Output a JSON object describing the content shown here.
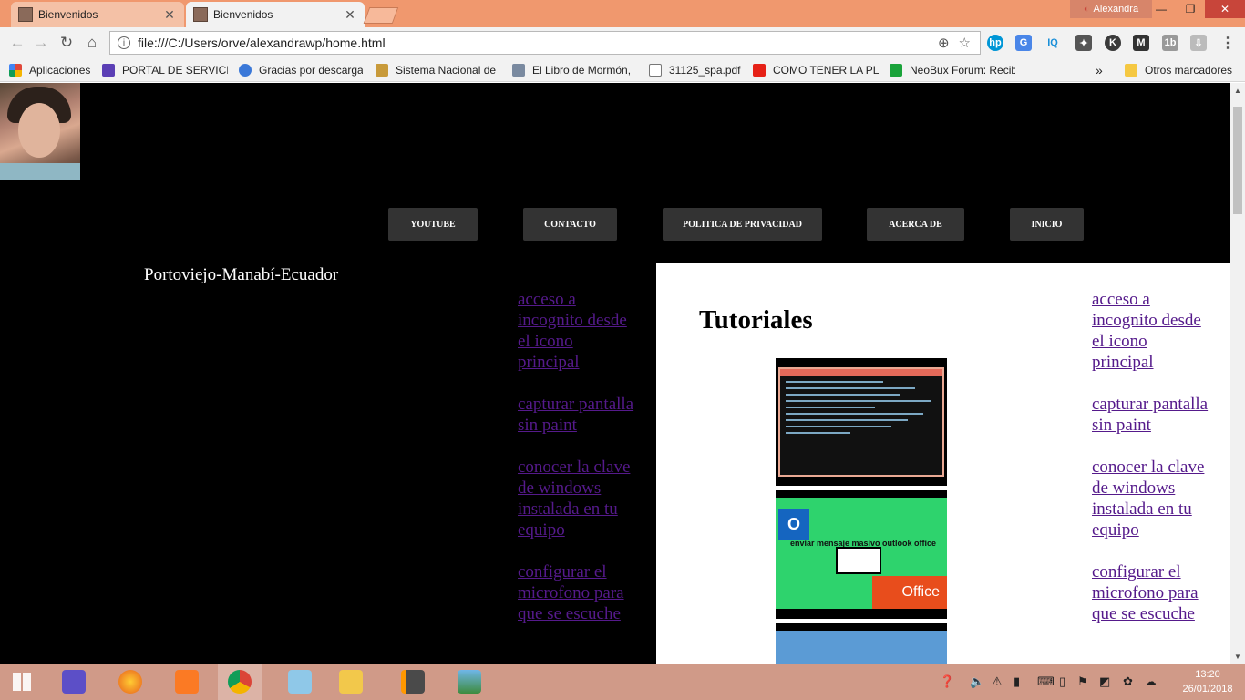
{
  "browser": {
    "tabs": [
      {
        "title": "Bienvenidos",
        "active": false
      },
      {
        "title": "Bienvenidos",
        "active": true
      }
    ],
    "profile_name": "Alexandra",
    "window_controls": {
      "minimize": "—",
      "maximize": "❐",
      "close": "✕"
    },
    "address": "file:///C:/Users/orve/alexandrawp/home.html",
    "extensions": [
      "hp-icon",
      "translate-icon",
      "iq-icon",
      "puzzle-icon",
      "k-icon",
      "m-icon",
      "1b-icon",
      "pdf-icon",
      "menu-icon"
    ],
    "bookmarks": [
      {
        "label": "Aplicaciones",
        "icon": "apps-grid-icon",
        "color": "#e0483a"
      },
      {
        "label": "PORTAL DE SERVICIO",
        "icon": "portal-icon",
        "color": "#5b3fb5"
      },
      {
        "label": "Gracias por descarga",
        "icon": "balloon-icon",
        "color": "#3a78d8"
      },
      {
        "label": "Sistema Nacional de",
        "icon": "pen-icon",
        "color": "#c89a3a"
      },
      {
        "label": "El Libro de Mormón,",
        "icon": "book-icon",
        "color": "#7a8aa0"
      },
      {
        "label": "31125_spa.pdf",
        "icon": "document-icon",
        "color": "#ffffff"
      },
      {
        "label": "COMO TENER LA PLA",
        "icon": "youtube-icon",
        "color": "#e62117"
      },
      {
        "label": "NeoBux Forum: Recib",
        "icon": "neobux-icon",
        "color": "#1aa33a"
      }
    ],
    "bookmarks_overflow": "»",
    "other_bookmarks": "Otros marcadores"
  },
  "page": {
    "nav": [
      "YOUTUBE",
      "CONTACTO",
      "POLITICA DE PRIVACIDAD",
      "ACERCA DE",
      "INICIO"
    ],
    "location": "Portoviejo-Manabí-Ecuador",
    "section_title": "Tutoriales",
    "links": [
      "acceso a incognito desde el icono principal",
      "capturar pantalla sin paint",
      "conocer la clave de windows instalada en tu equipo",
      "configurar el microfono para que se escuche"
    ],
    "thumb2_text": "enviar mensaje masivo outlook office",
    "thumb2_office": "Office",
    "colors": {
      "link_visited": "#551a8b",
      "nav_bg": "#333333",
      "page_bg": "#000000"
    }
  },
  "taskbar": {
    "apps": [
      "windows-start-icon",
      "settings-icon",
      "firefox-icon",
      "xampp-icon",
      "chrome-icon",
      "notepad-icon",
      "explorer-folder-icon",
      "sublime-icon",
      "photos-icon"
    ],
    "clock_time": "13:20",
    "clock_date": "26/01/2018"
  }
}
